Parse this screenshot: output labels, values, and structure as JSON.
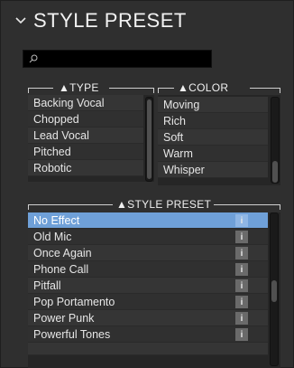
{
  "header": {
    "title": "STYLE PRESET"
  },
  "search": {
    "value": "",
    "placeholder": ""
  },
  "type_group": {
    "title": "▲TYPE",
    "items": [
      "Backing Vocal",
      "Chopped",
      "Lead Vocal",
      "Pitched",
      "Robotic"
    ]
  },
  "color_group": {
    "title": "▲COLOR",
    "items": [
      "Moving",
      "Rich",
      "Soft",
      "Warm",
      "Whisper"
    ]
  },
  "preset_group": {
    "title": "▲STYLE PRESET",
    "items": [
      "No Effect",
      "Old Mic",
      "Once Again",
      "Phone Call",
      "Pitfall",
      "Pop Portamento",
      "Power Punk",
      "Powerful Tones"
    ],
    "selected_index": 0,
    "info_label": "i"
  },
  "colors": {
    "selection": "#6fa0d8",
    "panel": "#2f2f2f"
  }
}
